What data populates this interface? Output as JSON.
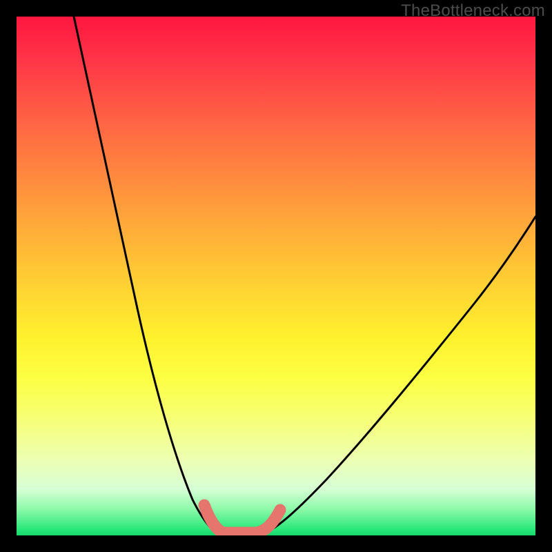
{
  "watermark": "TheBottleneck.com",
  "chart_data": {
    "type": "line",
    "title": "",
    "xlabel": "",
    "ylabel": "",
    "xlim": [
      0,
      100
    ],
    "ylim": [
      0,
      100
    ],
    "note": "Rainbow gradient background from red (top) to green (bottom); two black V-shaped curves meeting near bottom with a short pink/salmon flat segment at the trough.",
    "series": [
      {
        "name": "left-curve",
        "x": [
          11,
          15,
          20,
          25,
          30,
          33,
          36,
          38
        ],
        "y": [
          100,
          82,
          62,
          43,
          24,
          10,
          2,
          0
        ]
      },
      {
        "name": "right-curve",
        "x": [
          48,
          52,
          58,
          66,
          76,
          88,
          100
        ],
        "y": [
          0,
          3,
          9,
          18,
          30,
          46,
          62
        ]
      },
      {
        "name": "trough-highlight",
        "color": "#e5756d",
        "x": [
          36,
          38,
          40,
          44,
          47,
          49,
          51
        ],
        "y": [
          6,
          2,
          0.5,
          0.5,
          0.5,
          2,
          5
        ]
      }
    ]
  }
}
